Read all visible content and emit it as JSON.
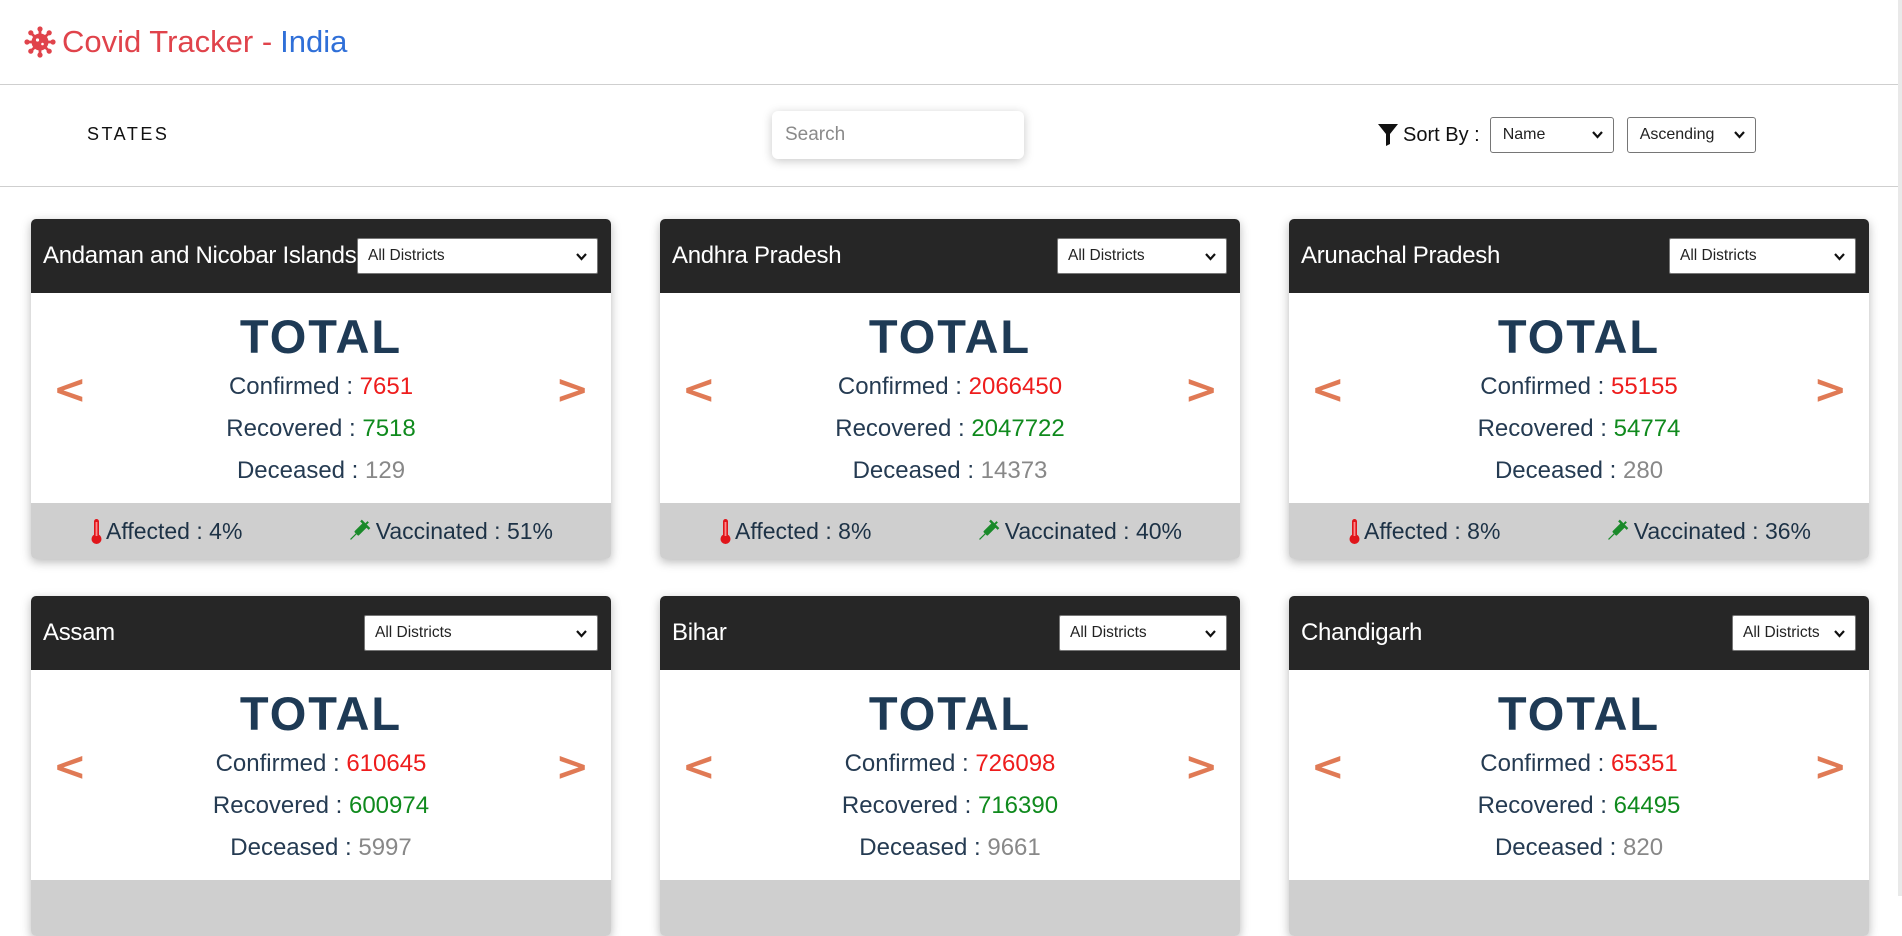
{
  "header": {
    "app_name": "Covid Tracker -",
    "country": "India",
    "logo_icon": "virus-icon"
  },
  "filters": {
    "states_label": "STATES",
    "search_placeholder": "Search",
    "sort_label": "Sort By :",
    "sort_field": "Name",
    "sort_order": "Ascending"
  },
  "labels": {
    "total": "TOTAL",
    "confirmed": "Confirmed :",
    "recovered": "Recovered :",
    "deceased": "Deceased :",
    "affected": "Affected :",
    "vaccinated": "Vaccinated :",
    "prev": "<",
    "next": ">"
  },
  "colors": {
    "confirmed": "#ee1c1c",
    "recovered": "#0f8a1d",
    "deceased": "#888888",
    "arrow": "#e07a55",
    "header_dark": "#262626"
  },
  "states": [
    {
      "name": "Andaman and Nicobar Islands",
      "district": "All Districts",
      "confirmed": "7651",
      "recovered": "7518",
      "deceased": "129",
      "affected": "4%",
      "vaccinated": "51%"
    },
    {
      "name": "Andhra Pradesh",
      "district": "All Districts",
      "confirmed": "2066450",
      "recovered": "2047722",
      "deceased": "14373",
      "affected": "8%",
      "vaccinated": "40%"
    },
    {
      "name": "Arunachal Pradesh",
      "district": "All Districts",
      "confirmed": "55155",
      "recovered": "54774",
      "deceased": "280",
      "affected": "8%",
      "vaccinated": "36%"
    },
    {
      "name": "Assam",
      "district": "All Districts",
      "confirmed": "610645",
      "recovered": "600974",
      "deceased": "5997"
    },
    {
      "name": "Bihar",
      "district": "All Districts",
      "confirmed": "726098",
      "recovered": "716390",
      "deceased": "9661"
    },
    {
      "name": "Chandigarh",
      "district": "All Districts",
      "confirmed": "65351",
      "recovered": "64495",
      "deceased": "820"
    }
  ]
}
